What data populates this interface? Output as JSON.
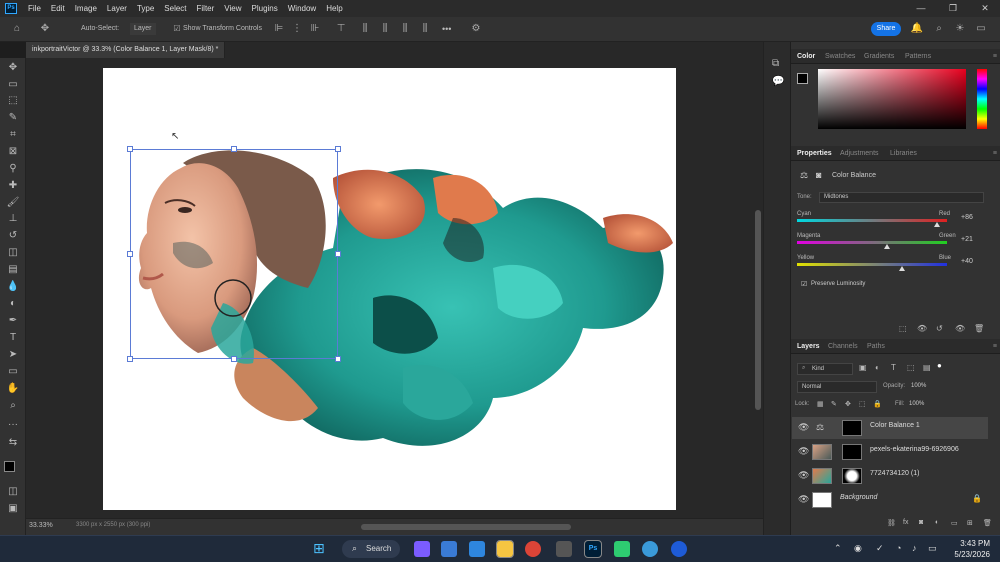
{
  "menubar": {
    "logo": "Ps",
    "items": [
      "File",
      "Edit",
      "Image",
      "Layer",
      "Type",
      "Select",
      "Filter",
      "View",
      "Plugins",
      "Window",
      "Help"
    ]
  },
  "options": {
    "auto_select_label": "Auto-Select:",
    "auto_select_value": "Layer",
    "show_transform_label": "Show Transform Controls",
    "more": "•••",
    "share": "Share"
  },
  "document": {
    "tab_title": "inkportraitVictor @ 33.3% (Color Balance 1, Layer Mask/8) *",
    "zoom": "33.33%",
    "dimensions": "3300 px x 2550 px (300 ppi)"
  },
  "color_panel": {
    "tabs": [
      "Color",
      "Swatches",
      "Gradients",
      "Patterns"
    ]
  },
  "properties_panel": {
    "tabs": [
      "Properties",
      "Adjustments",
      "Libraries"
    ],
    "title": "Color Balance",
    "tone_label": "Tone:",
    "tone_value": "Midtones",
    "sliders": [
      {
        "left": "Cyan",
        "right": "Red",
        "value": "+86",
        "level": 0.93
      },
      {
        "left": "Magenta",
        "right": "Green",
        "value": "+21",
        "level": 0.6
      },
      {
        "left": "Yellow",
        "right": "Blue",
        "value": "+40",
        "level": 0.7
      }
    ],
    "preserve_label": "Preserve Luminosity"
  },
  "layers_panel": {
    "tabs": [
      "Layers",
      "Channels",
      "Paths"
    ],
    "kind": "Kind",
    "blend_mode": "Normal",
    "opacity_label": "Opacity:",
    "opacity_value": "100%",
    "lock_label": "Lock:",
    "fill_label": "Fill:",
    "fill_value": "100%",
    "layers": [
      {
        "name": "Color Balance 1",
        "selected": true
      },
      {
        "name": "pexels-ekaterina99-6926906",
        "selected": false
      },
      {
        "name": "7724734120 (1)",
        "selected": false
      },
      {
        "name": "Background",
        "selected": false
      }
    ]
  },
  "taskbar": {
    "search": "Search",
    "time": "3:43 PM",
    "date": "5/23/2026"
  },
  "colors": {
    "accent": "#1473e6",
    "teal": "#2aa79b",
    "orange": "#e07a4c"
  }
}
